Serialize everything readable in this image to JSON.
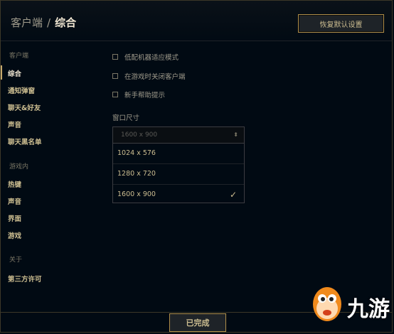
{
  "header": {
    "breadcrumb_parent": "客户端",
    "breadcrumb_separator": "/",
    "breadcrumb_current": "综合",
    "restore_defaults_label": "恢复默认设置"
  },
  "sidebar": {
    "sections": [
      {
        "heading": "客户端",
        "items": [
          "综合",
          "通知弹窗",
          "聊天&好友",
          "声音",
          "聊天黑名单"
        ]
      },
      {
        "heading": "游戏内",
        "items": [
          "热键",
          "声音",
          "界面",
          "游戏"
        ]
      },
      {
        "heading": "关于",
        "items": [
          "第三方许可"
        ]
      }
    ],
    "active_item": "综合"
  },
  "options": {
    "checkboxes": [
      {
        "label": "低配机器适应模式",
        "checked": false
      },
      {
        "label": "在游戏时关闭客户端",
        "checked": false
      },
      {
        "label": "新手帮助提示",
        "checked": false
      }
    ],
    "window_size": {
      "label": "窗口尺寸",
      "selected_value": "1600 x 900",
      "options": [
        "1024 x 576",
        "1280 x 720",
        "1600 x 900"
      ]
    }
  },
  "footer": {
    "done_label": "已完成"
  },
  "watermark": {
    "logo_text": "九游",
    "icon": "mascot-logo-icon"
  },
  "colors": {
    "background": "#010a13",
    "gold": "#c8aa6e",
    "gold_border": "#b08f4a",
    "text_light": "#f0e6d2",
    "text_gold": "#cdbe91",
    "text_muted": "#a09b8c"
  }
}
